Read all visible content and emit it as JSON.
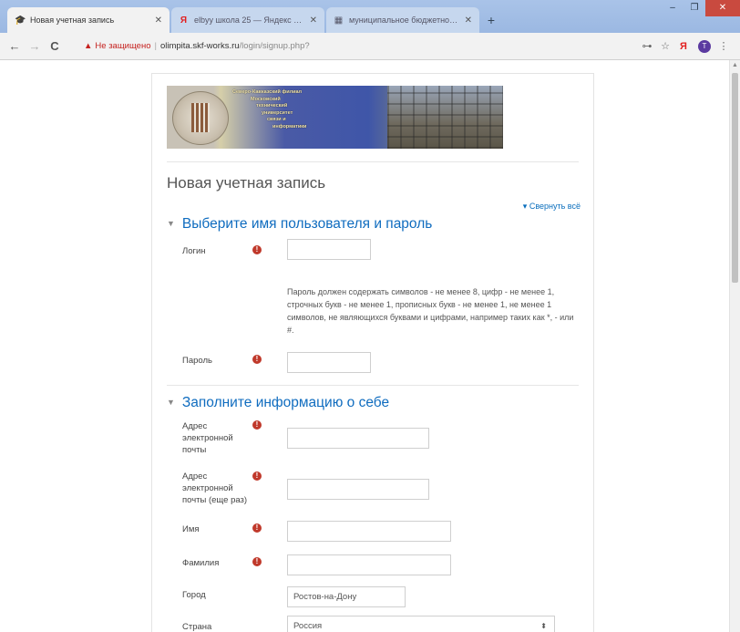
{
  "browser": {
    "tabs": [
      {
        "title": "Новая учетная запись",
        "favicon": "🎓"
      },
      {
        "title": "elbyy школа 25 — Яндекс нашл…",
        "favicon": "Я"
      },
      {
        "title": "муниципальное бюджетное о…",
        "favicon": "▦"
      }
    ],
    "new_tab_symbol": "+",
    "window_controls": [
      "–",
      "❐",
      "✕"
    ],
    "nav": {
      "back": "←",
      "forward": "→",
      "reload": "C"
    },
    "address": {
      "security_icon": "▲",
      "security_text": "Не защищено",
      "separator": "|",
      "host": "olimpita.skf-works.ru",
      "path": "/login/signup.php?"
    },
    "toolbar_icons": {
      "key": "⊶",
      "star": "☆",
      "yandex": "Я",
      "profile_letter": "T",
      "menu": "⋮"
    }
  },
  "banner": {
    "lines": [
      "Северо-Кавказский филиал",
      "Московский",
      "технический",
      "университет",
      "связи и",
      "информатики"
    ]
  },
  "page": {
    "title": "Новая учетная запись",
    "collapse_all": "Свернуть всё",
    "required_icon": "!"
  },
  "sections": [
    {
      "title": "Выберите имя пользователя и пароль"
    },
    {
      "title": "Заполните информацию о себе"
    }
  ],
  "fields": {
    "login": {
      "label": "Логин",
      "value": ""
    },
    "password_hint": "Пароль должен содержать символов - не менее 8, цифр - не менее 1, строчных букв - не менее 1, прописных букв - не менее 1, не менее 1 символов, не являющихся буквами и цифрами, например таких как *, - или #.",
    "password": {
      "label": "Пароль",
      "value": ""
    },
    "email": {
      "label": "Адрес электронной почты",
      "value": ""
    },
    "email2": {
      "label": "Адрес электронной почты (еще раз)",
      "value": ""
    },
    "firstname": {
      "label": "Имя",
      "value": ""
    },
    "lastname": {
      "label": "Фамилия",
      "value": ""
    },
    "city": {
      "label": "Город",
      "value": "Ростов-на-Дону"
    },
    "country": {
      "label": "Страна",
      "value": "Россия",
      "arrow": "⬍"
    }
  },
  "colors": {
    "link": "#0f6cbf",
    "required": "#c0392b",
    "insecure": "#c5221f"
  }
}
